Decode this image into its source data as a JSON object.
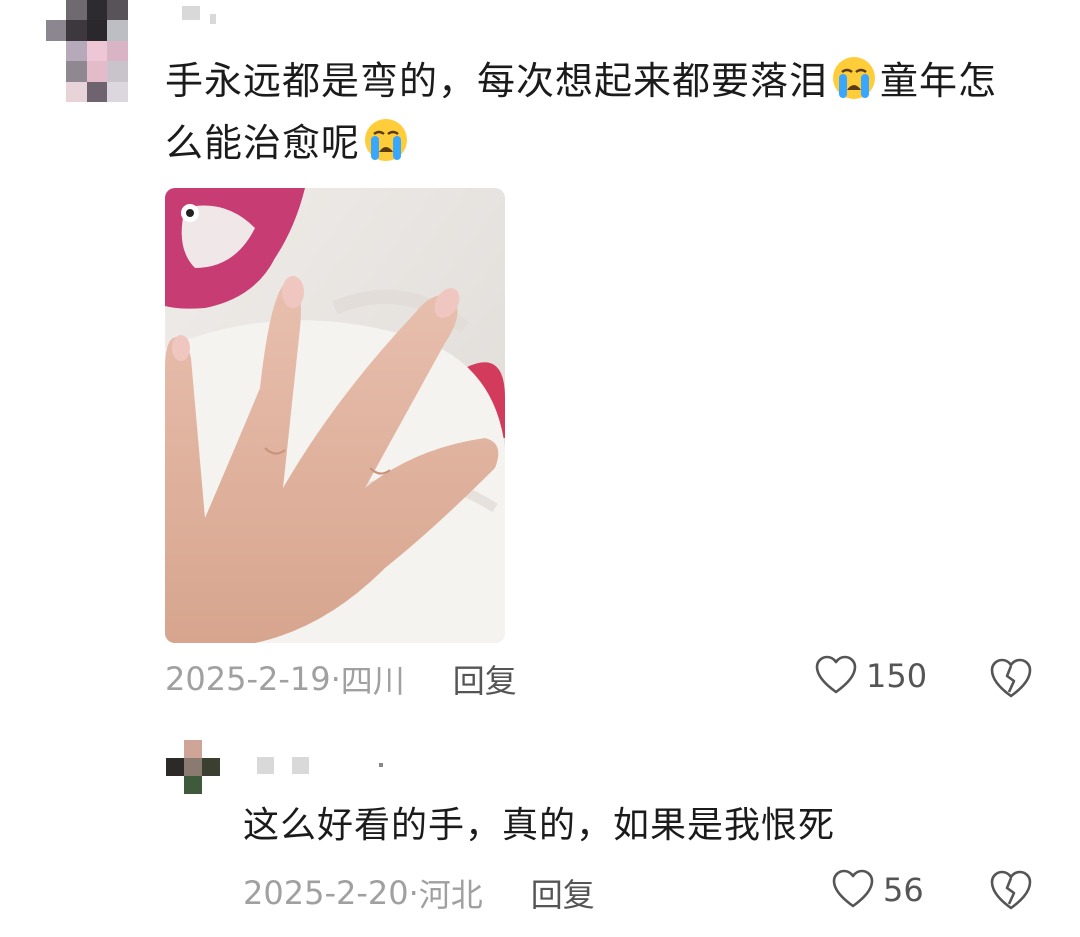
{
  "comment": {
    "text_line1_a": "手永远都是弯的，每次想起来都要落泪",
    "text_line1_b": "童年怎",
    "text_line2": "么能治愈呢",
    "emoji_icon": "loudly-crying-face-icon",
    "date": "2025-2-19",
    "separator": "·",
    "location": "四川",
    "reply_label": "回复",
    "like_count": "150"
  },
  "reply": {
    "text": "这么好看的手，真的，如果是我恨死",
    "date": "2025-2-20",
    "separator": "·",
    "location": "河北",
    "reply_label": "回复",
    "like_count": "56"
  },
  "icons": {
    "like": "heart-outline-icon",
    "dislike": "broken-heart-icon"
  },
  "colors": {
    "text": "#1b1b1b",
    "meta": "#a0a0a0",
    "action": "#555555"
  }
}
